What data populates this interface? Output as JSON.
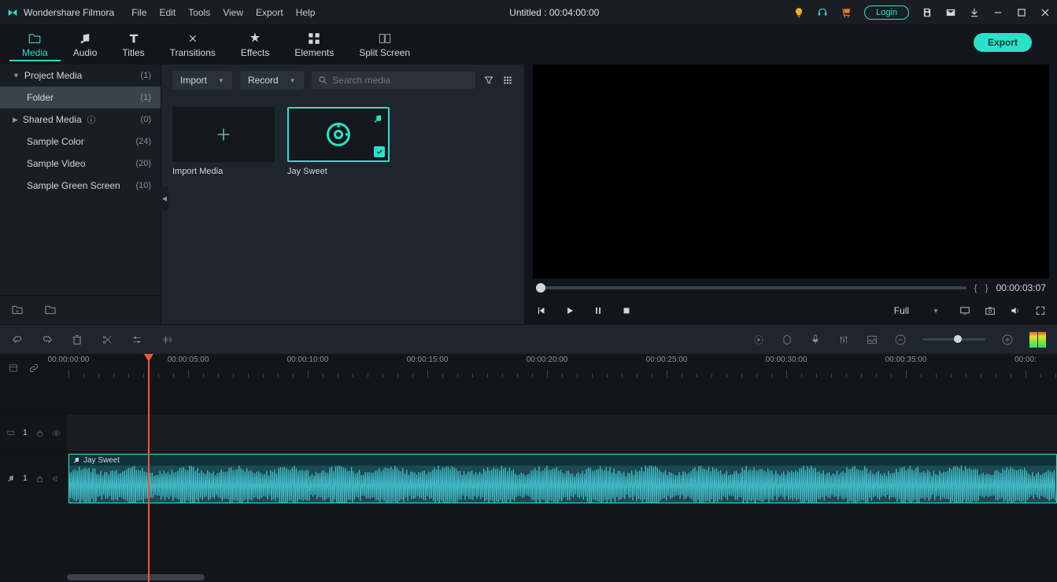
{
  "app": {
    "name": "Wondershare Filmora",
    "title": "Untitled : 00:04:00:00"
  },
  "menu": {
    "file": "File",
    "edit": "Edit",
    "tools": "Tools",
    "view": "View",
    "export": "Export",
    "help": "Help"
  },
  "login": "Login",
  "tabs": {
    "media": "Media",
    "audio": "Audio",
    "titles": "Titles",
    "transitions": "Transitions",
    "effects": "Effects",
    "elements": "Elements",
    "split": "Split Screen"
  },
  "exportBtn": "Export",
  "sidebar": {
    "projectMedia": {
      "label": "Project Media",
      "count": "(1)"
    },
    "folder": {
      "label": "Folder",
      "count": "(1)"
    },
    "sharedMedia": {
      "label": "Shared Media",
      "count": "(0)"
    },
    "sampleColor": {
      "label": "Sample Color",
      "count": "(24)"
    },
    "sampleVideo": {
      "label": "Sample Video",
      "count": "(20)"
    },
    "sampleGreen": {
      "label": "Sample Green Screen",
      "count": "(10)"
    }
  },
  "mediaPanel": {
    "importDd": "Import",
    "recordDd": "Record",
    "searchPh": "Search media",
    "importCard": "Import Media",
    "audioCard": "Jay Sweet"
  },
  "preview": {
    "timecode": "00:00:03:07",
    "zoomSel": "Full"
  },
  "ruler": {
    "labels": [
      "00:00:00:00",
      "00:00:05:00",
      "00:00:10:00",
      "00:00:15:00",
      "00:00:20:00",
      "00:00:25:00",
      "00:00:30:00",
      "00:00:35:00",
      "00:00:"
    ]
  },
  "tracks": {
    "video1": "1",
    "audio1": "1",
    "clip": "Jay Sweet"
  }
}
